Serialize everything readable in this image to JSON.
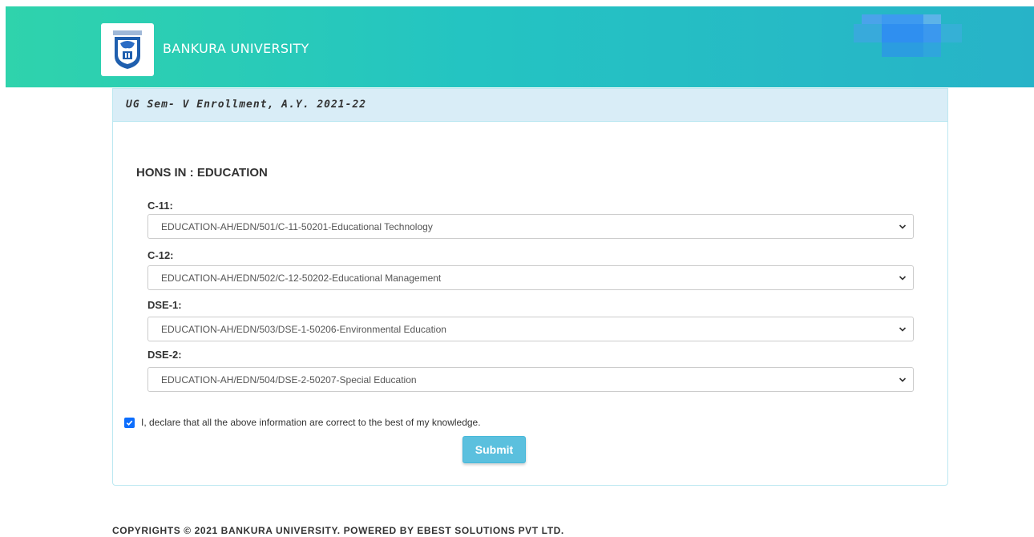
{
  "header": {
    "brand": "BANKURA UNIVERSITY",
    "logo_icon": "university-crest-icon",
    "gradient": [
      "#2fd3ac",
      "#27b3c8"
    ]
  },
  "panel": {
    "heading": "UG Sem- V Enrollment, A.Y. 2021-22",
    "section_title": "HONS IN : EDUCATION",
    "fields": [
      {
        "label": "C-11:",
        "selected": "EDUCATION-AH/EDN/501/C-11-50201-Educational Technology"
      },
      {
        "label": "C-12:",
        "selected": "EDUCATION-AH/EDN/502/C-12-50202-Educational Management"
      },
      {
        "label": "DSE-1:",
        "selected": "EDUCATION-AH/EDN/503/DSE-1-50206-Environmental Education"
      },
      {
        "label": "DSE-2:",
        "selected": "EDUCATION-AH/EDN/504/DSE-2-50207-Special Education"
      }
    ],
    "declaration": "I, declare that all the above information are correct to the best of my knowledge.",
    "declaration_checked": true,
    "submit_label": "Submit"
  },
  "footer": {
    "text": "COPYRIGHTS © 2021 BANKURA UNIVERSITY. POWERED BY EBEST SOLUTIONS PVT LTD."
  },
  "colors": {
    "panel_heading_bg": "#d9edf7",
    "panel_border": "#bce8f1",
    "submit_bg": "#5bc0de",
    "checkbox": "#0d6efd"
  }
}
